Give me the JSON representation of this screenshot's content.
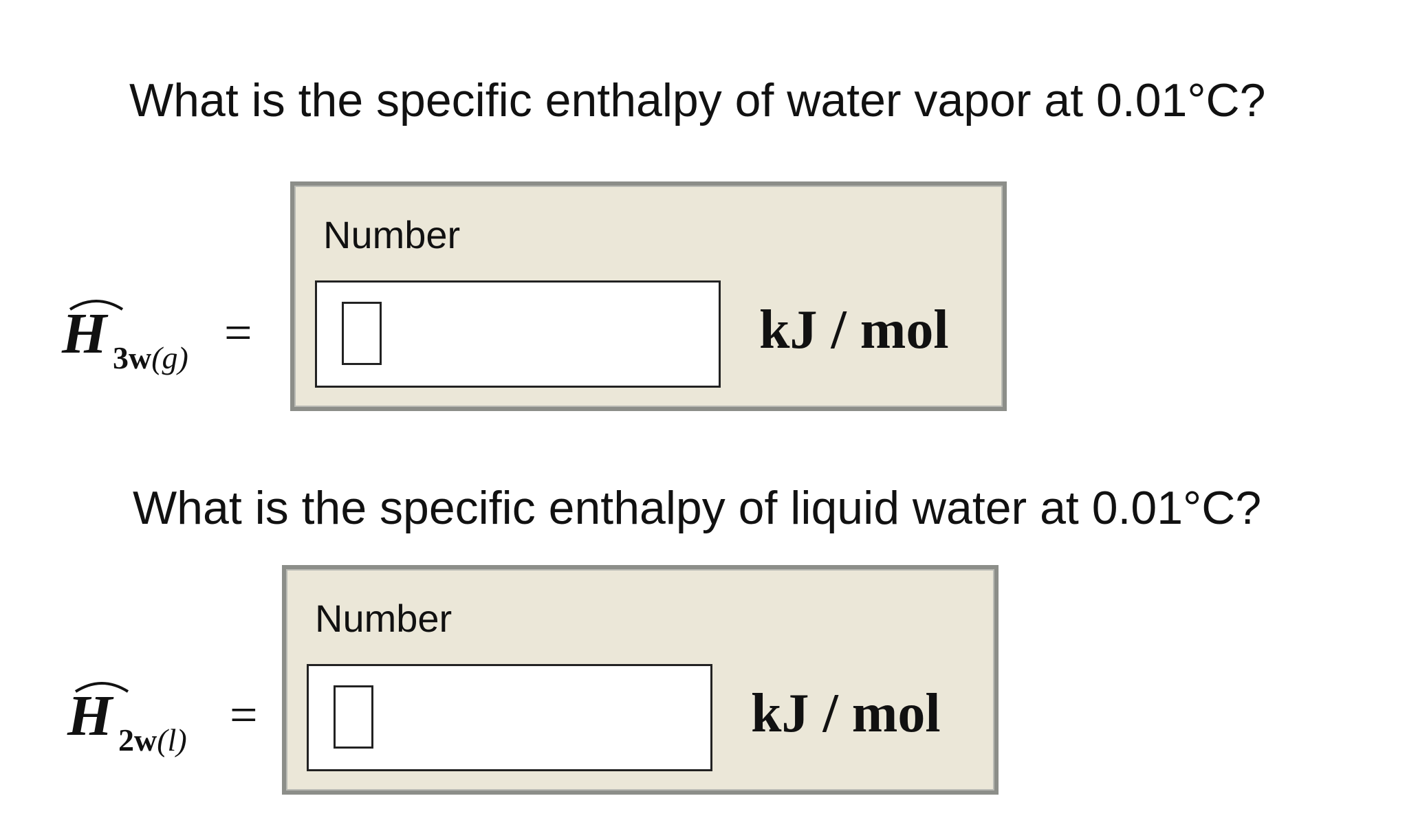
{
  "questions": [
    {
      "prompt": "What is the specific enthalpy of water vapor at 0.01°C?",
      "symbol": "H",
      "subscript": "3w",
      "phase": "(g)",
      "equals": "=",
      "field_label": "Number",
      "value": "",
      "unit": "kJ / mol"
    },
    {
      "prompt": "What is the specific enthalpy of liquid water at 0.01°C?",
      "symbol": "H",
      "subscript": "2w",
      "phase": "(l)",
      "equals": "=",
      "field_label": "Number",
      "value": "",
      "unit": "kJ / mol"
    }
  ]
}
